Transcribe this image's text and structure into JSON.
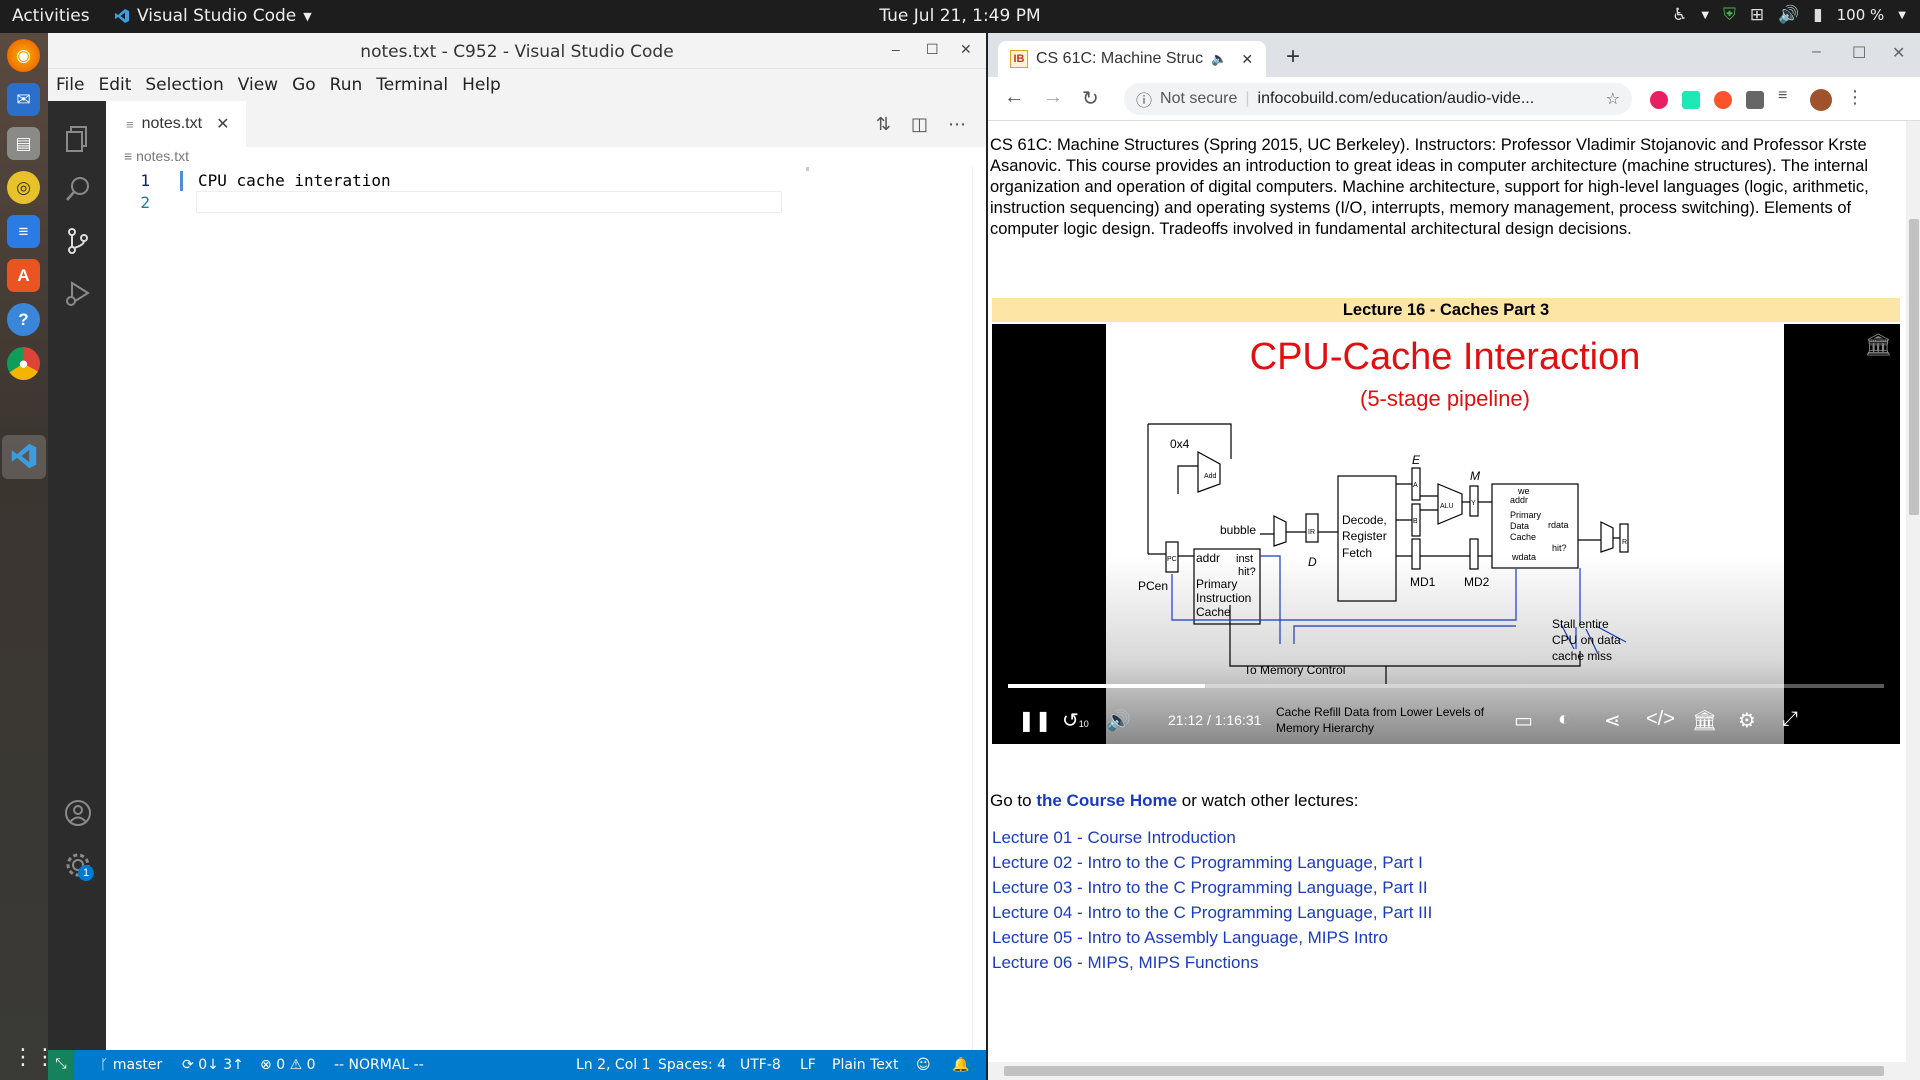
{
  "topbar": {
    "activities": "Activities",
    "app_name": "Visual Studio Code",
    "clock": "Tue Jul 21,  1:49 PM",
    "battery": "100 %"
  },
  "vscode": {
    "window_title": "notes.txt - C952 - Visual Studio Code",
    "menu": [
      "File",
      "Edit",
      "Selection",
      "View",
      "Go",
      "Run",
      "Terminal",
      "Help"
    ],
    "tab_label": "notes.txt",
    "breadcrumb": "notes.txt",
    "lines": [
      {
        "num": "1",
        "text": "CPU cache interation"
      },
      {
        "num": "2",
        "text": ""
      }
    ],
    "status": {
      "branch": "master",
      "sync": "0↓ 3↑",
      "errors": "0",
      "warnings": "0",
      "mode": "-- NORMAL --",
      "position": "Ln 2, Col 1",
      "spaces": "Spaces: 4",
      "encoding": "UTF-8",
      "eol": "LF",
      "language": "Plain Text",
      "settings_badge": "1"
    }
  },
  "chrome": {
    "tab_title": "CS 61C: Machine Struc",
    "favicon_text": "IB",
    "security": "Not secure",
    "url": "infocobuild.com/education/audio-vide...",
    "page": {
      "description": "CS 61C: Machine Structures (Spring 2015, UC Berkeley). Instructors: Professor Vladimir Stojanovic and Professor Krste Asanovic. This course provides an introduction to great ideas in computer architecture (machine structures). The internal organization and operation of digital computers. Machine architecture, support for high-level languages (logic, arithmetic, instruction sequencing) and operating systems (I/O, interrupts, memory management, process switching). Elements of computer logic design. Tradeoffs involved in fundamental architectural design decisions.",
      "lecture_header": "Lecture 16 - Caches Part 3",
      "video": {
        "slide_title": "CPU-Cache Interaction",
        "slide_subtitle": "(5-stage pipeline)",
        "diagram_labels": {
          "ox4": "0x4",
          "add": "Add",
          "pc": "PC",
          "pcen": "PCen",
          "bubble": "bubble",
          "ir": "IR",
          "d": "D",
          "addr": "addr",
          "inst": "inst",
          "hit": "hit?",
          "icache1": "Primary",
          "icache2": "Instruction",
          "icache3": "Cache",
          "decode1": "Decode,",
          "decode2": "Register",
          "decode3": "Fetch",
          "e": "E",
          "a": "A",
          "b": "B",
          "alu": "ALU",
          "m": "M",
          "y": "Y",
          "md1": "MD1",
          "md2": "MD2",
          "we": "we",
          "daddr": "addr",
          "dc1": "Primary",
          "dc2": "Data",
          "dc3": "Cache",
          "rdata": "rdata",
          "dhit": "hit?",
          "wdata": "wdata",
          "r": "R",
          "stall1": "Stall entire",
          "stall2": "CPU on data",
          "stall3": "cache miss",
          "memctl": "To Memory Control",
          "refill1": "Cache Refill Data from Lower Levels of",
          "refill2": "Memory Hierarchy"
        },
        "current_time": "21:12",
        "separator": "/",
        "duration": "1:16:31",
        "progress": 0.225,
        "rewind_label": "10"
      },
      "goto_prefix": "Go to ",
      "goto_link": "the Course Home",
      "goto_suffix": " or watch other lectures:",
      "lectures": [
        "Lecture 01 - Course Introduction",
        "Lecture 02 - Intro to the C Programming Language, Part I",
        "Lecture 03 - Intro to the C Programming Language, Part II",
        "Lecture 04 - Intro to the C Programming Language, Part III",
        "Lecture 05 - Intro to Assembly Language, MIPS Intro",
        "Lecture 06 - MIPS, MIPS Functions"
      ]
    }
  }
}
